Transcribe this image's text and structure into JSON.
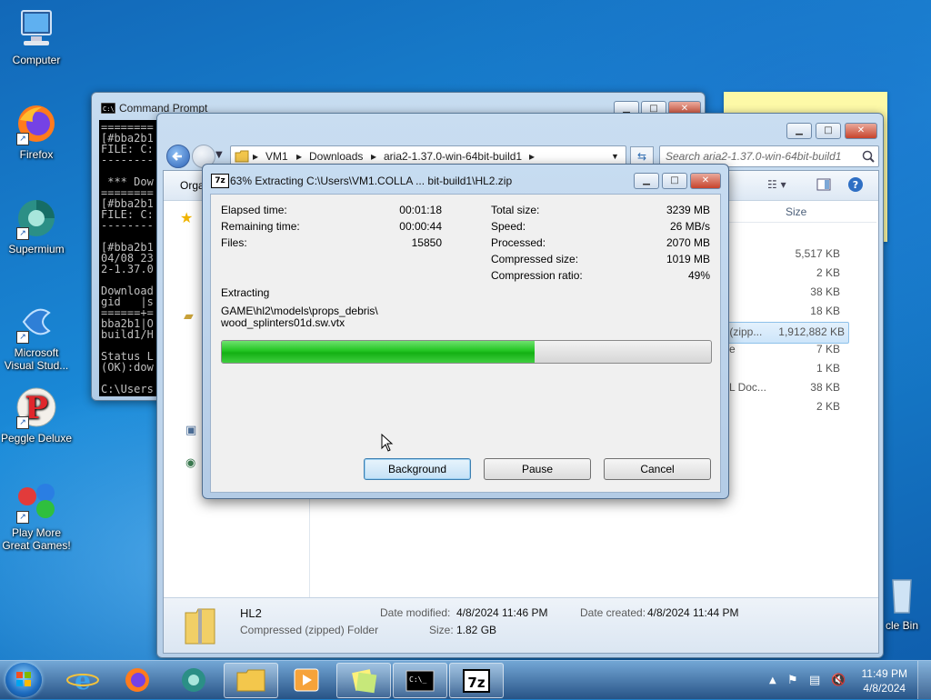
{
  "desktop": {
    "icons": [
      {
        "label": "Computer"
      },
      {
        "label": "Firefox"
      },
      {
        "label": "Supermium"
      },
      {
        "label": "Microsoft Visual Stud..."
      },
      {
        "label": "Peggle Deluxe"
      },
      {
        "label": "Play More Great Games!"
      }
    ],
    "recycle_bin_label": "cle Bin"
  },
  "cmd_window": {
    "title": "Command Prompt",
    "lines": "========\n[#bba2b1\nFILE: C:\n--------\n\n *** Dow\n========\n[#bba2b1\nFILE: C:\n--------\n\n[#bba2b1\n04/08 23\n2-1.37.0\n\nDownload\ngid   |s\n======+=\nbba2b1|O\nbuild1/H\n\nStatus L\n(OK):dow\n\nC:\\Users"
  },
  "explorer": {
    "address": {
      "crumbs": [
        "VM1",
        "Downloads",
        "aria2-1.37.0-win-64bit-build1"
      ],
      "separator": "▸"
    },
    "search_placeholder": "Search aria2-1.37.0-win-64bit-build1",
    "toolbar_organize": "Orga",
    "column_size": "Size",
    "rows": [
      {
        "type": "",
        "size": "5,517 KB"
      },
      {
        "type": "",
        "size": "2 KB"
      },
      {
        "type": "",
        "size": "38 KB"
      },
      {
        "type": "",
        "size": "18 KB"
      },
      {
        "type": "r (zipp...",
        "size": "1,912,882 KB"
      },
      {
        "type": "e",
        "size": "7 KB"
      },
      {
        "type": "",
        "size": "1 KB"
      },
      {
        "type": "L Doc...",
        "size": "38 KB"
      },
      {
        "type": "",
        "size": "2 KB"
      }
    ],
    "details": {
      "name": "HL2",
      "kind": "Compressed (zipped) Folder",
      "modified_label": "Date modified:",
      "modified_value": "4/8/2024 11:46 PM",
      "created_label": "Date created:",
      "created_value": "4/8/2024 11:44 PM",
      "size_label": "Size:",
      "size_value": "1.82 GB"
    }
  },
  "dialog": {
    "app_icon": "7z",
    "title": "63% Extracting C:\\Users\\VM1.COLLA ... bit-build1\\HL2.zip",
    "left_stats": [
      {
        "label": "Elapsed time:",
        "value": "00:01:18"
      },
      {
        "label": "Remaining time:",
        "value": "00:00:44"
      },
      {
        "label": "Files:",
        "value": "15850"
      }
    ],
    "right_stats": [
      {
        "label": "Total size:",
        "value": "3239 MB"
      },
      {
        "label": "Speed:",
        "value": "26 MB/s"
      },
      {
        "label": "Processed:",
        "value": "2070 MB"
      },
      {
        "label": "Compressed size:",
        "value": "1019 MB"
      },
      {
        "label": "Compression ratio:",
        "value": "49%"
      }
    ],
    "status_label": "Extracting",
    "current_path_line1": "GAME\\hl2\\models\\props_debris\\",
    "current_path_line2": "wood_splinters01d.sw.vtx",
    "progress_fraction": 0.64,
    "buttons": {
      "background": "Background",
      "pause": "Pause",
      "cancel": "Cancel"
    }
  },
  "taskbar": {
    "time": "11:49 PM",
    "date": "4/8/2024"
  },
  "colors": {
    "progress_green": "#22c422",
    "accent_blue": "#1a8ad8"
  }
}
